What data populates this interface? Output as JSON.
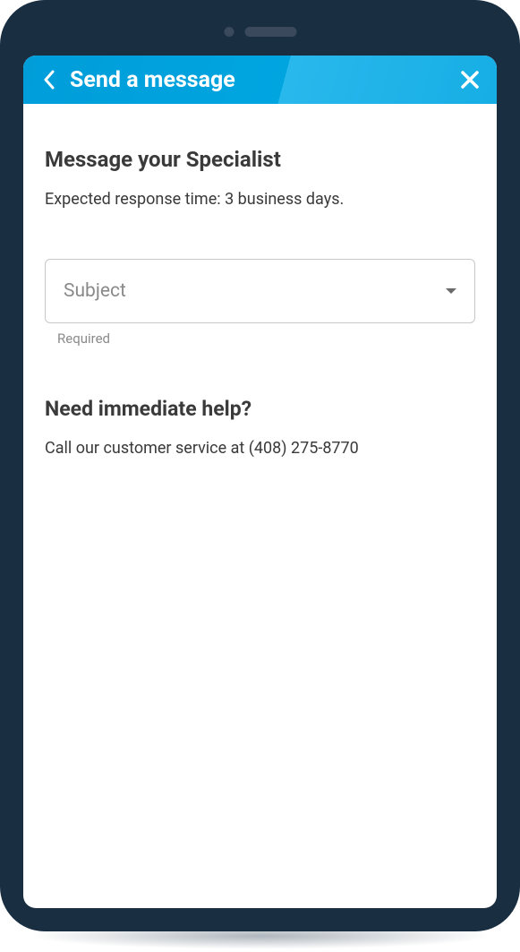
{
  "header": {
    "title": "Send a message"
  },
  "main": {
    "heading": "Message your Specialist",
    "responseTime": "Expected response time: 3 business days."
  },
  "subjectField": {
    "placeholder": "Subject",
    "requiredLabel": "Required"
  },
  "help": {
    "heading": "Need immediate help?",
    "text": "Call our customer service at (408) 275-8770"
  }
}
